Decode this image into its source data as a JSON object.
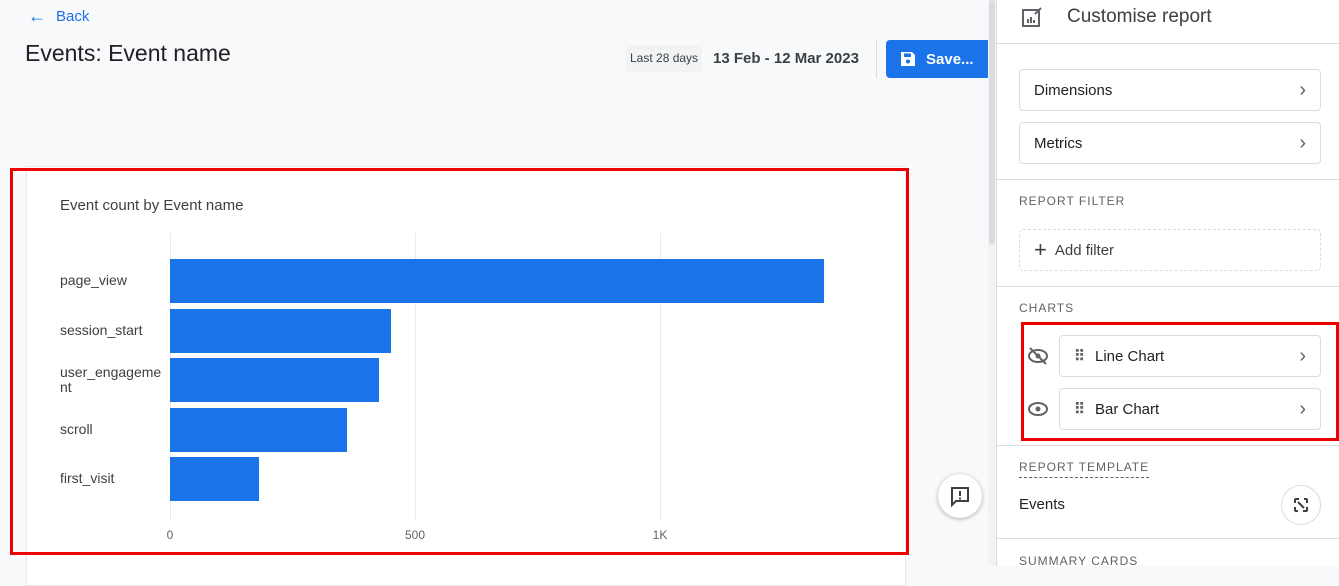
{
  "header": {
    "back_label": "Back",
    "title": "Events: Event name",
    "range_chip": "Last 28 days",
    "range": "13 Feb - 12 Mar 2023",
    "save_label": "Save..."
  },
  "chart_data": {
    "type": "bar",
    "orientation": "horizontal",
    "title": "Event count by Event name",
    "categories": [
      "page_view",
      "session_start",
      "user_engageme nt",
      "scroll",
      "first_visit"
    ],
    "values": [
      1335,
      451,
      427,
      361,
      182
    ],
    "xticks": [
      0,
      500,
      1000
    ],
    "xtick_labels": [
      "0",
      "500",
      "1K"
    ],
    "xlim": [
      0,
      1400
    ],
    "color": "#1a73e8"
  },
  "panel": {
    "title": "Customise report",
    "dimensions": "Dimensions",
    "metrics": "Metrics",
    "filter_heading": "REPORT FILTER",
    "add_filter": "Add filter",
    "charts_heading": "CHARTS",
    "charts": [
      {
        "label": "Line Chart",
        "visible": false
      },
      {
        "label": "Bar Chart",
        "visible": true
      }
    ],
    "template_heading": "REPORT TEMPLATE",
    "template_name": "Events",
    "summary_heading": "SUMMARY CARDS"
  }
}
